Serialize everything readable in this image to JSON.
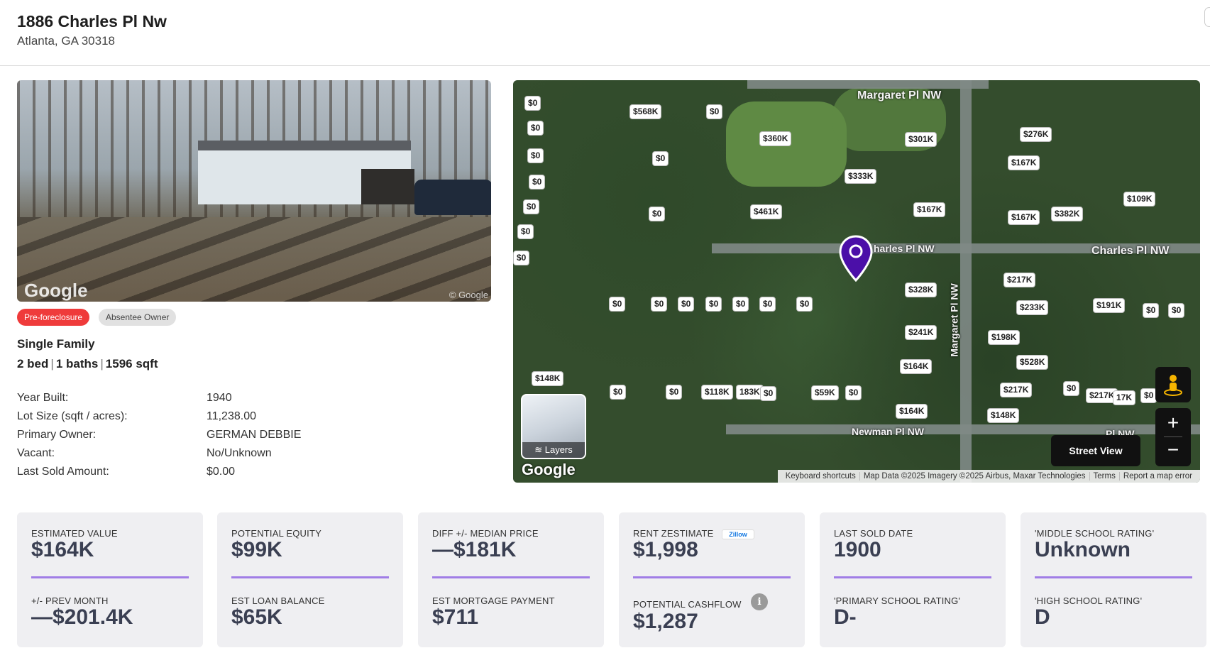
{
  "address": {
    "street": "1886 Charles Pl Nw",
    "city_line": "Atlanta, GA 30318"
  },
  "badges": [
    {
      "label": "Pre-foreclosure",
      "color": "#ef3b3b"
    },
    {
      "label": "Absentee Owner",
      "color": "#e1e1e1"
    }
  ],
  "property": {
    "type": "Single Family",
    "beds": "2 bed",
    "baths": "1 baths",
    "sqft": "1596 sqft",
    "sep": "|"
  },
  "facts": [
    {
      "label": "Year Built:",
      "value": "1940"
    },
    {
      "label": "Lot Size (sqft / acres):",
      "value": "11,238.00"
    },
    {
      "label": "Primary Owner:",
      "value": "GERMAN DEBBIE"
    },
    {
      "label": "Vacant:",
      "value": "No/Unknown"
    },
    {
      "label": "Last Sold Amount:",
      "value": "$0.00"
    }
  ],
  "photo": {
    "watermark": "Google",
    "credit": "© Google"
  },
  "map": {
    "streets": [
      "Margaret Pl NW",
      "Charles Pl NW",
      "harles Pl NW",
      "Margaret Pl NW",
      "Newman Pl NW",
      "Pl NW"
    ],
    "price_labels": [
      "$0",
      "$0",
      "$0",
      "$0",
      "$0",
      "$0",
      "$0",
      "$568K",
      "$0",
      "$360K",
      "$301K",
      "$276K",
      "$0",
      "$167K",
      "$333K",
      "$0",
      "$461K",
      "$167K",
      "$109K",
      "$167K",
      "$382K",
      "$0",
      "$0",
      "$0",
      "$0",
      "$0",
      "$0",
      "$0",
      "$328K",
      "$217K",
      "$233K",
      "$191K",
      "$0",
      "$0",
      "$241K",
      "$198K",
      "$148K",
      "$164K",
      "$528K",
      "$0",
      "$0",
      "$118K",
      "183K",
      "$0",
      "$59K",
      "$0",
      "$217K",
      "$0",
      "$217K",
      "17K",
      "$0",
      "$164K",
      "$148K"
    ],
    "layers_label": "Layers",
    "google_label": "Google",
    "attribution": [
      "Keyboard shortcuts",
      "Map Data ©2025 Imagery ©2025 Airbus, Maxar Technologies",
      "Terms",
      "Report a map error"
    ],
    "street_view_label": "Street View",
    "zoom_in": "+",
    "zoom_out": "−",
    "icons": [
      "map-pin-icon",
      "pegman-icon",
      "layers-icon"
    ]
  },
  "cards": [
    {
      "top_label": "ESTIMATED VALUE",
      "top_value": "$164K",
      "bottom_label": "+/- PREV MONTH",
      "bottom_value": "—$201.4K"
    },
    {
      "top_label": "POTENTIAL EQUITY",
      "top_value": "$99K",
      "bottom_label": "EST LOAN BALANCE",
      "bottom_value": "$65K"
    },
    {
      "top_label": "DIFF +/- MEDIAN PRICE",
      "top_value": "—$181K",
      "bottom_label": "EST MORTGAGE PAYMENT",
      "bottom_value": "$711"
    },
    {
      "top_label": "RENT ZESTIMATE",
      "top_value": "$1,998",
      "bottom_label": "POTENTIAL CASHFLOW",
      "bottom_value": "$1,287",
      "badge": "Zillow",
      "info": "i"
    },
    {
      "top_label": "LAST SOLD DATE",
      "top_value": "1900",
      "bottom_label": "'PRIMARY SCHOOL RATING'",
      "bottom_value": "D-"
    },
    {
      "top_label": "'MIDDLE SCHOOL RATING'",
      "top_value": "Unknown",
      "bottom_label": "'HIGH SCHOOL RATING'",
      "bottom_value": "D"
    }
  ],
  "colors": {
    "accent": "#a07de6",
    "pin": "#4b0fa8",
    "badge_red": "#ef3b3b",
    "card_bg": "#efeff2"
  }
}
